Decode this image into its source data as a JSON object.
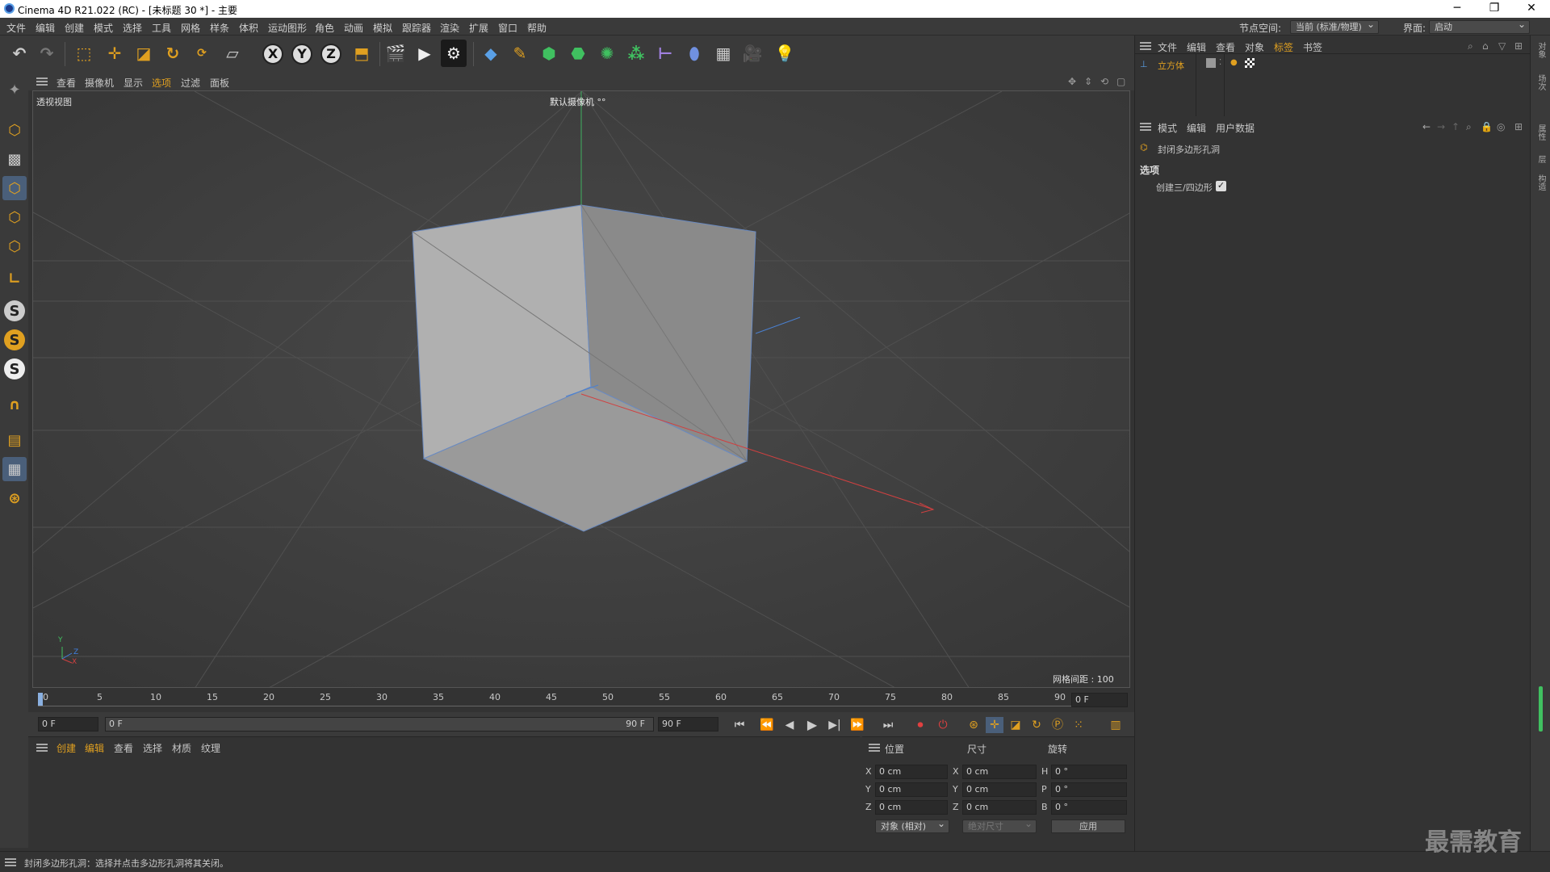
{
  "window": {
    "title": "Cinema 4D R21.022 (RC) - [未标题 30 *] - 主要",
    "minimize": "─",
    "restore": "❐",
    "close": "✕"
  },
  "menubar": {
    "items": [
      "文件",
      "编辑",
      "创建",
      "模式",
      "选择",
      "工具",
      "网格",
      "样条",
      "体积",
      "运动图形",
      "角色",
      "动画",
      "模拟",
      "跟踪器",
      "渲染",
      "扩展",
      "窗口",
      "帮助"
    ],
    "node_space_label": "节点空间:",
    "node_space_value": "当前 (标准/物理)",
    "layout_label": "界面:",
    "layout_value": "启动"
  },
  "toolbar": {
    "axis_x": "X",
    "axis_y": "Y",
    "axis_z": "Z"
  },
  "viewport": {
    "menu": [
      "查看",
      "摄像机",
      "显示",
      "选项",
      "过滤",
      "面板"
    ],
    "view_name": "透视视图",
    "camera_label": "默认摄像机 °°",
    "grid_spacing": "网格间距 : 100 cm",
    "axis_y": "Y",
    "axis_z": "Z",
    "axis_x": "X"
  },
  "timeline": {
    "ticks": [
      "0",
      "5",
      "10",
      "15",
      "20",
      "25",
      "30",
      "35",
      "40",
      "45",
      "50",
      "55",
      "60",
      "65",
      "70",
      "75",
      "80",
      "85",
      "90"
    ],
    "current_frame_right": "0 F",
    "start_field": "0 F",
    "range_start": "0 F",
    "range_end": "90 F",
    "end_field": "90 F"
  },
  "material_panel": {
    "menu": [
      "创建",
      "编辑",
      "查看",
      "选择",
      "材质",
      "纹理"
    ]
  },
  "coords": {
    "headers": [
      "位置",
      "尺寸",
      "旋转"
    ],
    "rows": [
      {
        "axis": "X",
        "pos": "0 cm",
        "size_axis": "X",
        "size": "0 cm",
        "rot_axis": "H",
        "rot": "0 °"
      },
      {
        "axis": "Y",
        "pos": "0 cm",
        "size_axis": "Y",
        "size": "0 cm",
        "rot_axis": "P",
        "rot": "0 °"
      },
      {
        "axis": "Z",
        "pos": "0 cm",
        "size_axis": "Z",
        "size": "0 cm",
        "rot_axis": "B",
        "rot": "0 °"
      }
    ],
    "mode_select": "对象 (相对)",
    "size_select": "绝对尺寸",
    "apply_button": "应用"
  },
  "object_manager": {
    "menu": [
      "文件",
      "编辑",
      "查看",
      "对象",
      "标签",
      "书签"
    ],
    "object_name": "立方体"
  },
  "attribute_manager": {
    "menu": [
      "模式",
      "编辑",
      "用户数据"
    ],
    "tool_name": "封闭多边形孔洞",
    "section": "选项",
    "option_label": "创建三/四边形",
    "option_checked": true
  },
  "right_strip": [
    "对象",
    "场次",
    "属性",
    "层",
    "构造"
  ],
  "statusbar": {
    "text": "封闭多边形孔洞：选择并点击多边形孔洞将其关闭。"
  },
  "watermark": "最需教育",
  "colors": {
    "accent_orange": "#e0a020",
    "selected_tab": "#e0a020",
    "x_axis": "#d04040",
    "y_axis": "#40c060",
    "z_axis": "#4080e0"
  }
}
